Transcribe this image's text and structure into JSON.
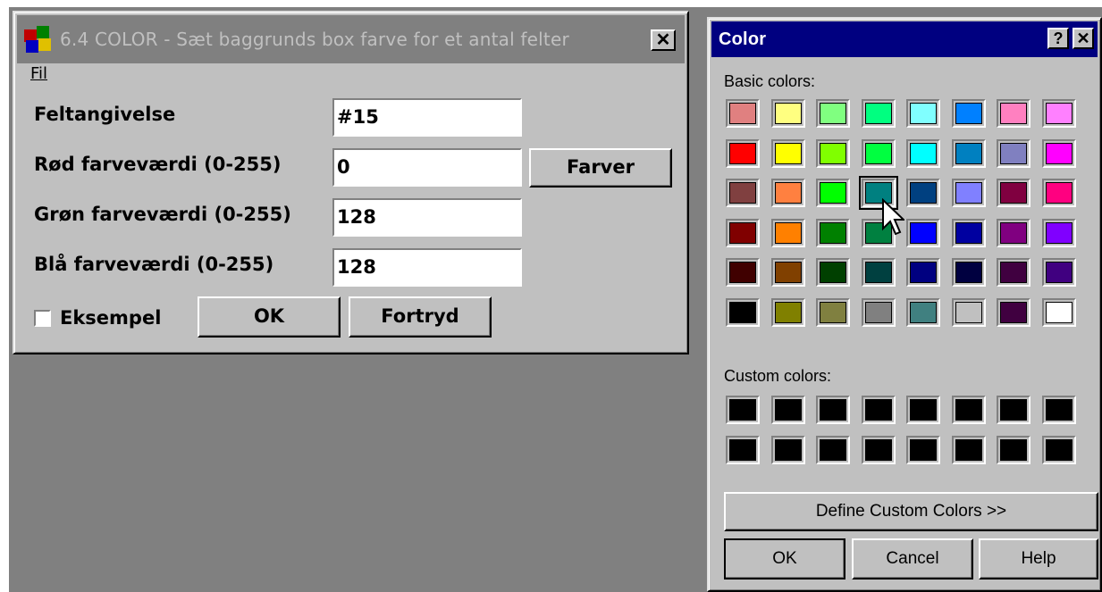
{
  "main_window": {
    "title": "6.4 COLOR - Sæt baggrunds box farve for et antal felter",
    "close_label": "✕",
    "menu": {
      "file": "Fil"
    },
    "fields": [
      {
        "label": "Feltangivelse",
        "value": "#15"
      },
      {
        "label": "Rød farveværdi (0-255)",
        "value": "0"
      },
      {
        "label": "Grøn farveværdi (0-255)",
        "value": "128"
      },
      {
        "label": "Blå farveværdi (0-255)",
        "value": "128"
      }
    ],
    "farver_button": "Farver",
    "example_checkbox": {
      "label": "Eksempel",
      "checked": false
    },
    "ok_button": "OK",
    "cancel_button": "Fortryd"
  },
  "color_dialog": {
    "title": "Color",
    "help_label": "?",
    "close_label": "✕",
    "basic_colors_label": "Basic colors:",
    "basic_colors": [
      [
        "#e08080",
        "#ffff80",
        "#80ff80",
        "#00ff80",
        "#80ffff",
        "#0080ff",
        "#ff80c0",
        "#ff80ff"
      ],
      [
        "#ff0000",
        "#ffff00",
        "#80ff00",
        "#00ff40",
        "#00ffff",
        "#0080c0",
        "#8080c0",
        "#ff00ff"
      ],
      [
        "#804040",
        "#ff8040",
        "#00ff00",
        "#008080",
        "#004080",
        "#8080ff",
        "#800040",
        "#ff0080"
      ],
      [
        "#800000",
        "#ff8000",
        "#008000",
        "#008040",
        "#0000ff",
        "#0000a0",
        "#800080",
        "#8000ff"
      ],
      [
        "#400000",
        "#804000",
        "#004000",
        "#004040",
        "#000080",
        "#000040",
        "#400040",
        "#400080"
      ],
      [
        "#000000",
        "#808000",
        "#808040",
        "#808080",
        "#408080",
        "#c0c0c0",
        "#400040",
        "#ffffff"
      ]
    ],
    "selected_basic": {
      "row": 2,
      "col": 3
    },
    "custom_colors_label": "Custom colors:",
    "custom_colors": [
      [
        "#000000",
        "#000000",
        "#000000",
        "#000000",
        "#000000",
        "#000000",
        "#000000",
        "#000000"
      ],
      [
        "#000000",
        "#000000",
        "#000000",
        "#000000",
        "#000000",
        "#000000",
        "#000000",
        "#000000"
      ]
    ],
    "define_button": "Define Custom Colors >>",
    "ok_button": "OK",
    "cancel_button": "Cancel",
    "help_button": "Help"
  }
}
